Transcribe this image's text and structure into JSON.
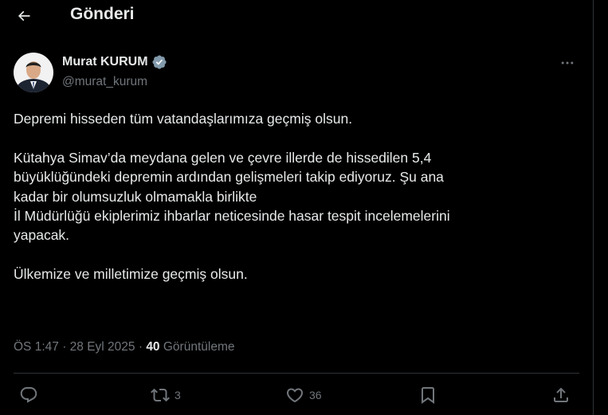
{
  "header": {
    "title": "Gönderi",
    "back_icon": "arrow-left-icon"
  },
  "author": {
    "name": "Murat KURUM",
    "handle": "@murat_kurum",
    "verified": true,
    "verified_color": "#829aab"
  },
  "tweet": {
    "paragraph1": "Depremi hisseden tüm vatandaşlarımıza geçmiş olsun.",
    "paragraph2_lines": [
      "Kütahya Simav’da meydana gelen ve çevre illerde de hissedilen 5,4",
      "büyüklüğündeki depremin ardından gelişmeleri takip ediyoruz. Şu ana",
      "kadar bir olumsuzluk olmamakla birlikte",
      "İl Müdürlüğü ekiplerimiz ihbarlar neticesinde hasar tespit incelemelerini",
      "yapacak."
    ],
    "paragraph3": "Ülkemize ve milletimize geçmiş olsun."
  },
  "meta": {
    "time": "ÖS 1:47",
    "separator": "·",
    "date": "28 Eyl 2025",
    "views_count": "40",
    "views_label": "Görüntüleme"
  },
  "actions": {
    "reply_count": "",
    "retweet_count": "3",
    "like_count": "36"
  },
  "colors": {
    "background": "#000000",
    "text_primary": "#e7e9ea",
    "text_secondary": "#71767b",
    "border": "#2f3336"
  }
}
